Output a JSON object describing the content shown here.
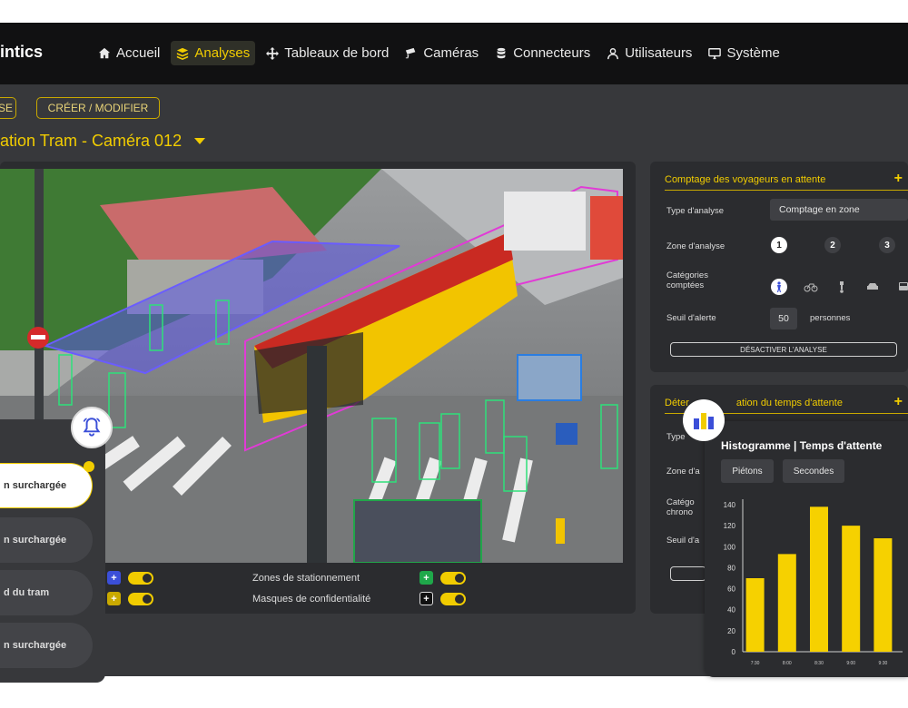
{
  "brand": "intics",
  "nav": [
    {
      "label": "Accueil",
      "icon": "home-icon"
    },
    {
      "label": "Analyses",
      "icon": "layers-icon",
      "active": true
    },
    {
      "label": "Tableaux de bord",
      "icon": "move-icon"
    },
    {
      "label": "Caméras",
      "icon": "camera-icon"
    },
    {
      "label": "Connecteurs",
      "icon": "database-icon"
    },
    {
      "label": "Utilisateurs",
      "icon": "user-icon"
    },
    {
      "label": "Système",
      "icon": "monitor-icon"
    }
  ],
  "mode_buttons": {
    "consult": "SE",
    "edit": "CRÉER / MODIFIER"
  },
  "page_title": "ation Tram - Caméra 012",
  "video_toggles": {
    "parking_zones": "Zones de stationnement",
    "privacy_masks": "Masques de confidentialité"
  },
  "panel_counting": {
    "title": "Comptage des voyageurs en attente",
    "type_label": "Type d'analyse",
    "type_value": "Comptage en zone",
    "zone_label": "Zone d'analyse",
    "zones": [
      "1",
      "2",
      "3"
    ],
    "categories_label": "Catégories comptées",
    "threshold_label": "Seuil d'alerte",
    "threshold_value": "50",
    "threshold_unit": "personnes",
    "deactivate_label": "DÉSACTIVER L'ANALYSE"
  },
  "panel_waiting": {
    "title_left": "Déter",
    "title_right": "ation du temps d'attente",
    "labels": [
      "Type",
      "Zone d'a",
      "Catégo chrono",
      "Seuil d'a"
    ]
  },
  "notifications": [
    {
      "text": "n surchargée",
      "active": true
    },
    {
      "text": "n surchargée"
    },
    {
      "text": "d du tram"
    },
    {
      "text": "n surchargée"
    }
  ],
  "histogram": {
    "title": "Histogramme | Temps d'attente",
    "chips": [
      "Piétons",
      "Secondes"
    ]
  },
  "colors": {
    "accent": "#f1cc00",
    "bg": "#37383b",
    "panel": "#2b2c2f"
  },
  "chart_data": {
    "type": "bar",
    "categories": [
      "7:30",
      "8:00",
      "8:30",
      "9:00",
      "9:30"
    ],
    "values": [
      70,
      93,
      138,
      120,
      108
    ],
    "ylim": [
      0,
      140
    ],
    "yticks": [
      0,
      20,
      40,
      60,
      80,
      100,
      120,
      140
    ],
    "title": "Histogramme | Temps d'attente",
    "grid": false
  }
}
